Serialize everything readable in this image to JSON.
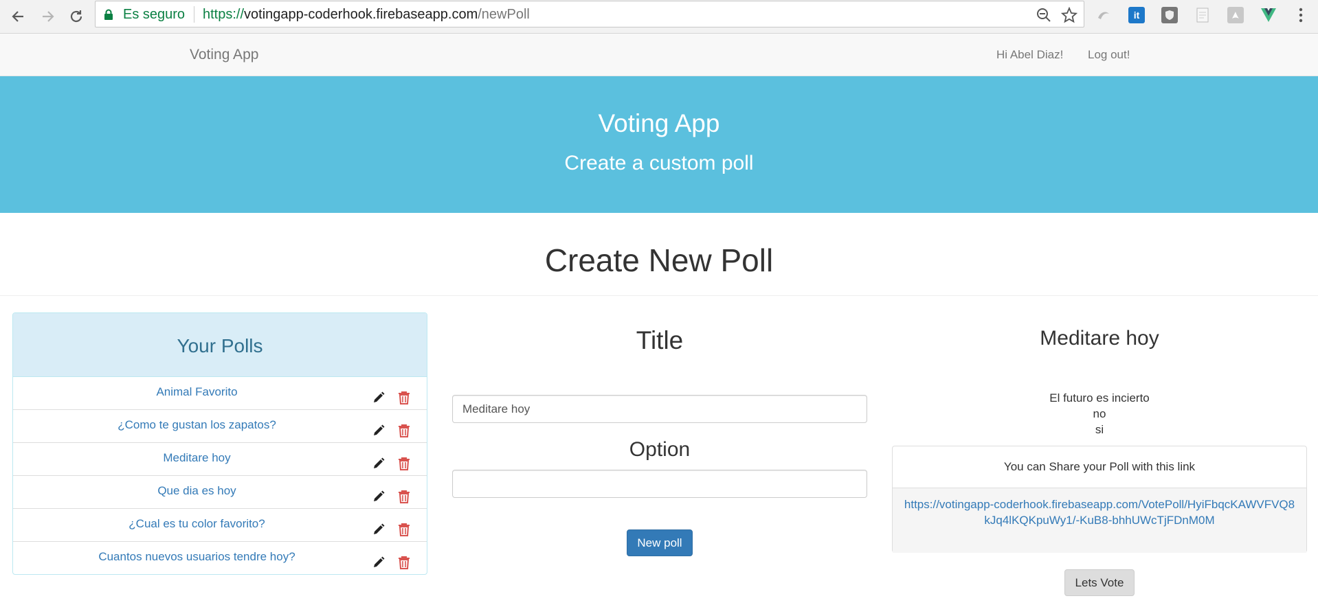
{
  "browser": {
    "secure_label": "Es seguro",
    "url_scheme": "https://",
    "url_host": "votingapp-coderhook.firebaseapp.com",
    "url_path": "/newPoll",
    "extensions": [
      "ext-swirl-icon",
      "ext-it-icon",
      "ext-shield-icon",
      "ext-doc-icon",
      "ext-pdf-icon",
      "ext-vue-icon"
    ]
  },
  "navbar": {
    "brand": "Voting App",
    "greeting": "Hi Abel Diaz!",
    "logout": "Log out!"
  },
  "hero": {
    "title": "Voting App",
    "subtitle": "Create a custom poll",
    "bg_color": "#5bc0de"
  },
  "page_title": "Create New Poll",
  "polls_panel": {
    "heading": "Your Polls",
    "polls": [
      "Animal Favorito",
      "¿Como te gustan los zapatos?",
      "Meditare hoy",
      "Que dia es hoy",
      "¿Cual es tu color favorito?",
      "Cuantos nuevos usuarios tendre hoy?"
    ]
  },
  "form": {
    "title_label": "Title",
    "title_value": "Meditare hoy",
    "option_label": "Option",
    "option_value": "",
    "submit_label": "New poll"
  },
  "preview": {
    "title": "Meditare hoy",
    "options": [
      "El futuro es incierto",
      "no",
      "si"
    ],
    "share_heading": "You can Share your Poll with this link",
    "share_link": "https://votingapp-coderhook.firebaseapp.com/VotePoll/HyiFbqcKAWVFVQ8kJq4lKQKpuWy1/-KuB8-bhhUWcTjFDnM0M",
    "vote_button": "Lets Vote"
  }
}
